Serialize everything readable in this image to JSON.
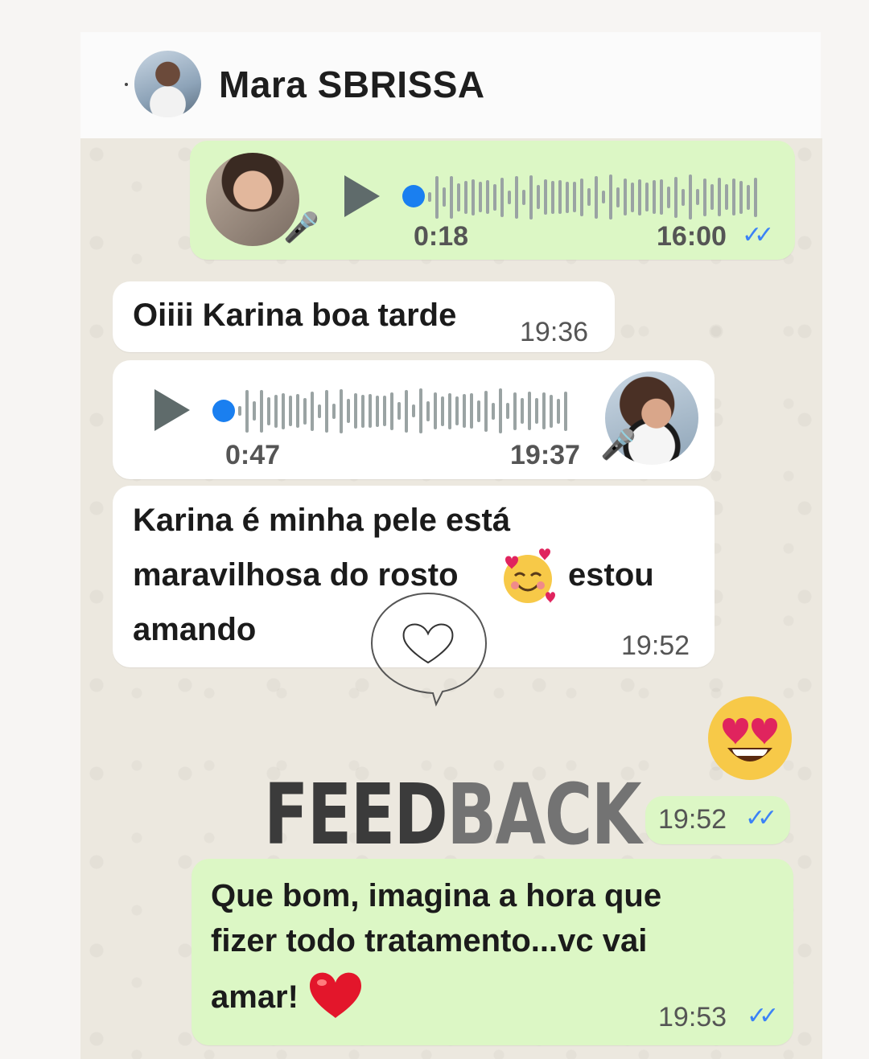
{
  "header": {
    "contact_name": "Mara SBRISSA",
    "avatar_icon": "contact-avatar"
  },
  "messages": [
    {
      "id": "m1",
      "type": "voice",
      "direction": "out",
      "duration": "0:18",
      "time": "16:00",
      "read": true
    },
    {
      "id": "m2",
      "type": "text",
      "direction": "in",
      "text": "Oiiii Karina boa tarde",
      "time": "19:36"
    },
    {
      "id": "m3",
      "type": "voice",
      "direction": "in",
      "duration": "0:47",
      "time": "19:37"
    },
    {
      "id": "m4",
      "type": "text",
      "direction": "in",
      "lines": [
        "Karina é minha pele está",
        "maravilhosa do rosto",
        "estou",
        "amando"
      ],
      "time": "19:52"
    },
    {
      "id": "m5",
      "type": "emoji",
      "direction": "out",
      "emoji": "heart-eyes",
      "time": "19:52",
      "read": true
    },
    {
      "id": "m6",
      "type": "text",
      "direction": "out",
      "lines": [
        "Que bom, imagina a hora que",
        "fizer todo tratamento...vc vai",
        "amar!"
      ],
      "time": "19:53",
      "read": true
    }
  ],
  "overlay": {
    "word_dark": "FEED",
    "word_light": "BACK"
  },
  "colors": {
    "outgoing": "#dcf7c5",
    "incoming": "#ffffff",
    "read_ticks": "#3b82f6",
    "voice_dot": "#1a7ff0"
  }
}
